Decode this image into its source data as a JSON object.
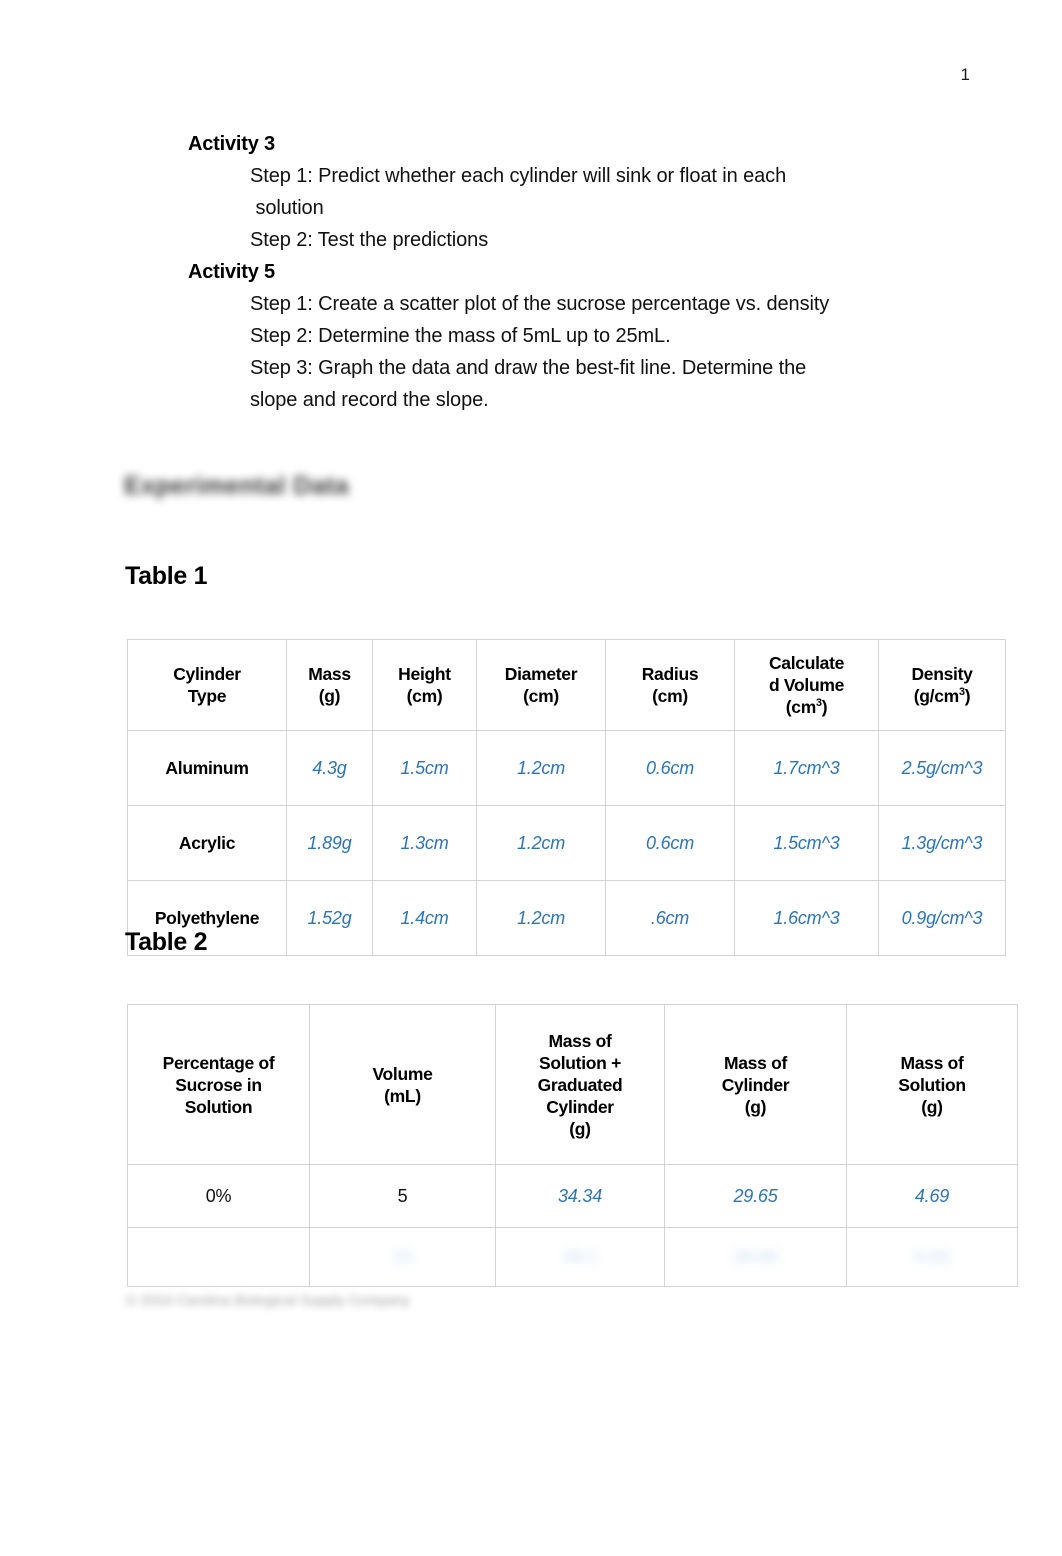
{
  "document": {
    "page_number": "1",
    "section_heading_blurred": "Experimental Data",
    "footer_blurred": "© 2024 Carolina Biological Supply Company"
  },
  "procedure": {
    "activities": [
      {
        "title": "Activity 3",
        "steps": [
          "Step 1: Predict whether each cylinder will sink or float in each",
          " solution",
          "Step 2: Test the predictions"
        ]
      },
      {
        "title": "Activity 5",
        "steps": [
          "Step 1: Create a scatter plot of the sucrose percentage vs. density",
          "Step 2: Determine the mass of 5mL up to 25mL.",
          "Step 3: Graph the data and draw the best-fit line. Determine the",
          "slope and record the slope."
        ]
      }
    ]
  },
  "table1": {
    "caption": "Table 1",
    "headers": {
      "cylinder_type": "Cylinder Type",
      "mass": "Mass (g)",
      "height": "Height (cm)",
      "diameter": "Diameter (cm)",
      "radius": "Radius (cm)",
      "volume": "Calculated Volume (cm³)",
      "density": "Density (g/cm³)"
    },
    "header_parts": {
      "cylinder_type_l1": "Cylinder",
      "cylinder_type_l2": "Type",
      "mass_l1": "Mass",
      "mass_l2": "(g)",
      "height_l1": "Height",
      "height_l2": "(cm)",
      "diameter_l1": "Diameter",
      "diameter_l2": "(cm)",
      "radius_l1": "Radius",
      "radius_l2": "(cm)",
      "volume_l1": "Calculate",
      "volume_l2": "d Volume",
      "volume_l3": "(cm",
      "volume_sup": "3",
      "volume_l4": ")",
      "density_l1": "Density",
      "density_l2": "(g/cm",
      "density_sup": "3",
      "density_l3": ")"
    },
    "rows": [
      {
        "type": "Aluminum",
        "mass": "4.3g",
        "height": "1.5cm",
        "diameter": "1.2cm",
        "radius": "0.6cm",
        "volume": "1.7cm^3",
        "density": "2.5g/cm^3"
      },
      {
        "type": "Acrylic",
        "mass": "1.89g",
        "height": "1.3cm",
        "diameter": "1.2cm",
        "radius": "0.6cm",
        "volume": "1.5cm^3",
        "density": "1.3g/cm^3"
      },
      {
        "type": "Polyethylene",
        "mass": "1.52g",
        "height": "1.4cm",
        "diameter": "1.2cm",
        "radius": ".6cm",
        "volume": "1.6cm^3",
        "density": "0.9g/cm^3"
      }
    ]
  },
  "table2": {
    "caption": "Table 2",
    "headers": {
      "percentage": "Percentage of Sucrose in Solution",
      "volume": "Volume (mL)",
      "mass_solution_cylinder": "Mass of Solution + Graduated Cylinder (g)",
      "mass_cylinder": "Mass of Cylinder (g)",
      "mass_solution": "Mass of Solution (g)"
    },
    "header_parts": {
      "percentage_l1": "Percentage of",
      "percentage_l2": "Sucrose in",
      "percentage_l3": "Solution",
      "volume_l1": "Volume",
      "volume_l2": "(mL)",
      "msc_l1": "Mass of",
      "msc_l2": "Solution +",
      "msc_l3": "Graduated",
      "msc_l4": "Cylinder",
      "msc_l5": "(g)",
      "mc_l1": "Mass of",
      "mc_l2": "Cylinder",
      "mc_l3": "(g)",
      "ms_l1": "Mass of",
      "ms_l2": "Solution",
      "ms_l3": "(g)"
    },
    "rows": [
      {
        "percentage": "0%",
        "volume": "5",
        "mass_solution_cylinder": "34.34",
        "mass_cylinder": "29.65",
        "mass_solution": "4.69"
      }
    ],
    "redacted_row": {
      "percentage": "",
      "volume": "10",
      "mass_solution_cylinder": "39.1",
      "mass_cylinder": "29.65",
      "mass_solution": "9.45"
    }
  },
  "colors": {
    "entry_blue": "#2e74b5",
    "table_border": "#d3d3d3",
    "text_black": "#000000"
  }
}
